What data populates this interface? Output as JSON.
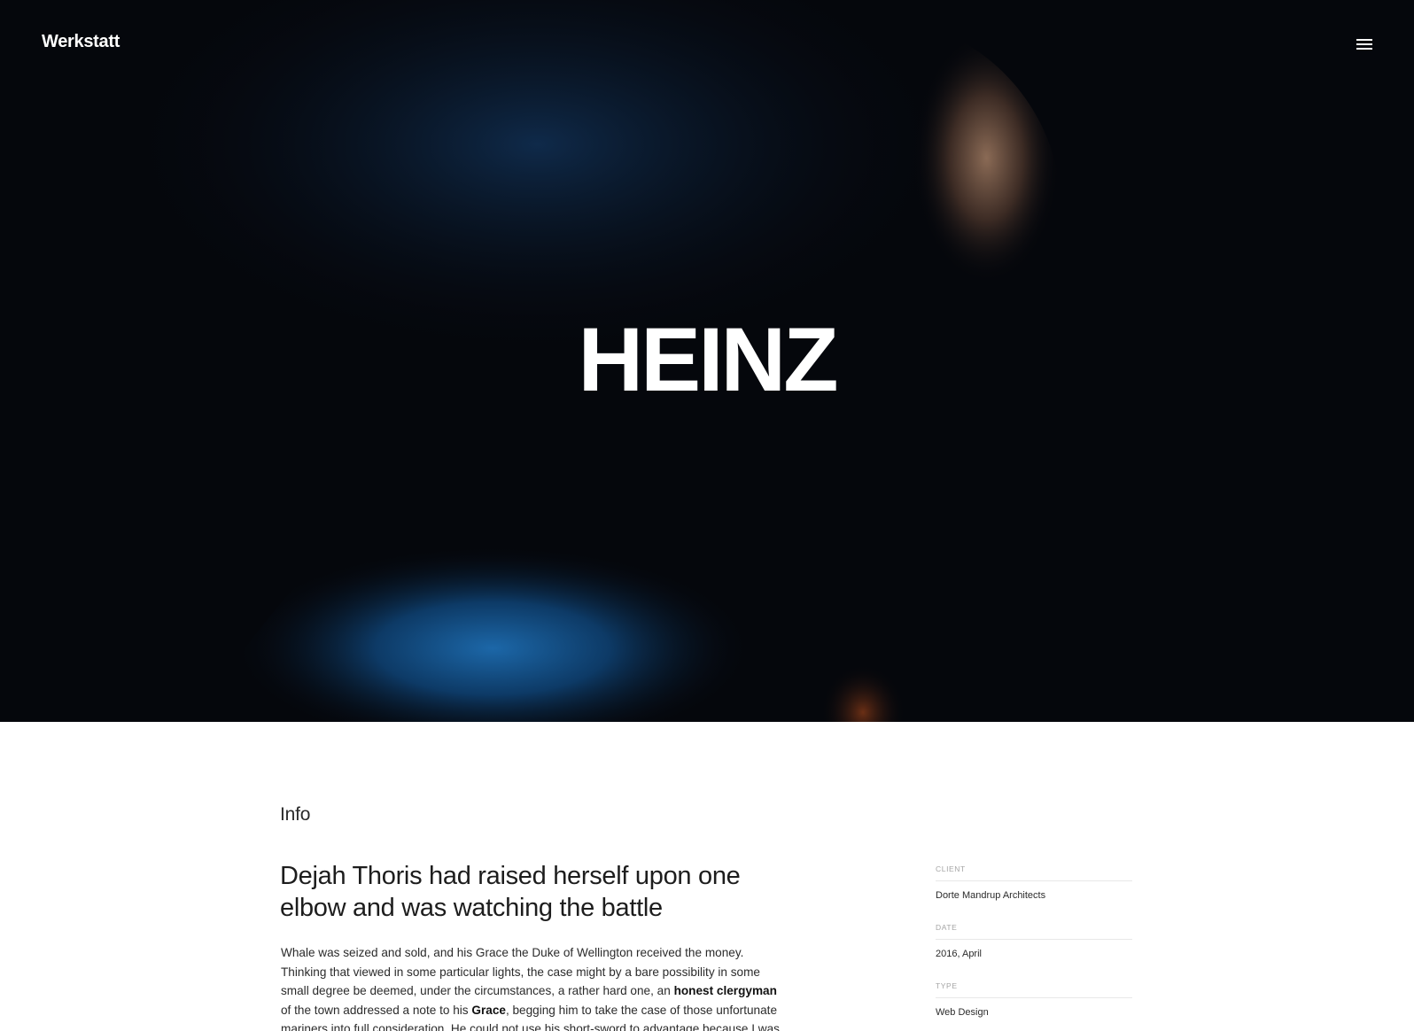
{
  "header": {
    "logo": "Werkstatt",
    "menu_icon": "hamburger-menu-icon"
  },
  "hero": {
    "title": "HEINZ",
    "image": "portrait-photo-blue-orange-light"
  },
  "content": {
    "section_label": "Info",
    "headline": "Dejah Thoris had raised herself upon one elbow and was watching the battle",
    "paragraph": {
      "part1": "Whale was seized and sold, and his Grace the Duke of Wellington received the money. Thinking that viewed in some particular lights, the case might by a bare possibility in some small degree be deemed, under the circumstances, a rather hard one, an ",
      "bold1": "honest clergyman",
      "part2": " of the town addressed a note to his ",
      "bold2": "Grace",
      "part3": ", begging him to take the case of those unfortunate mariners into full consideration. He could not use his short-sword to advantage because I was too close to him"
    }
  },
  "meta": [
    {
      "key": "Client",
      "value": "Dorte Mandrup Architects"
    },
    {
      "key": "Date",
      "value": "2016, April"
    },
    {
      "key": "Type",
      "value": "Web Design"
    }
  ]
}
